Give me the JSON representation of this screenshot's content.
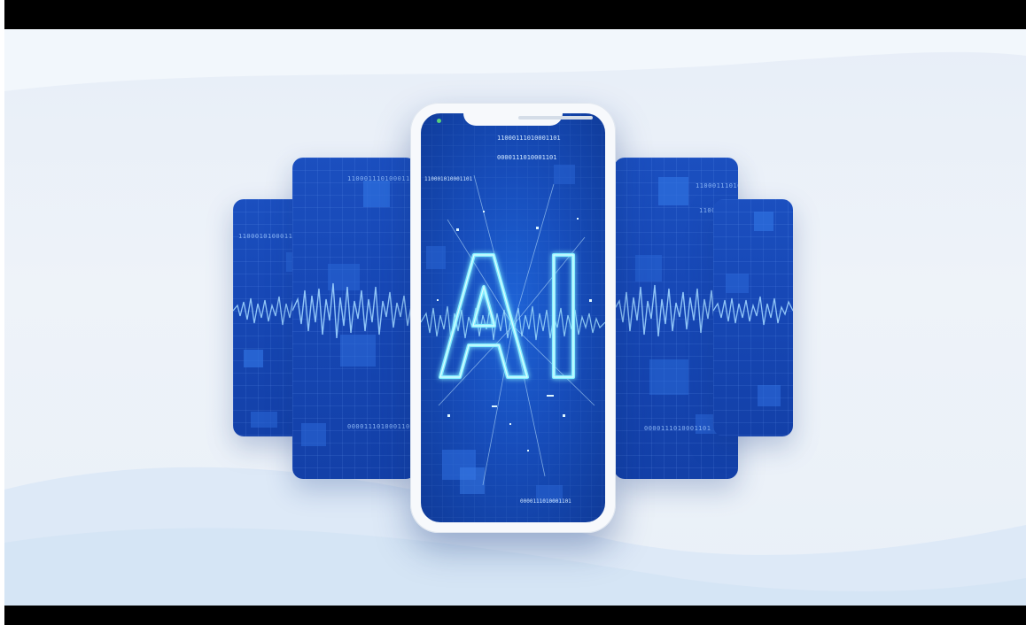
{
  "scene": {
    "subject": "AI",
    "code_strings": [
      "11000111010001101",
      "0000111010001101",
      "110001010001101"
    ],
    "colors": {
      "background": "#e9f0f8",
      "card_blue": "#1748b6",
      "phone_body": "#f7f9fc",
      "glow": "#7fe8ff"
    }
  }
}
